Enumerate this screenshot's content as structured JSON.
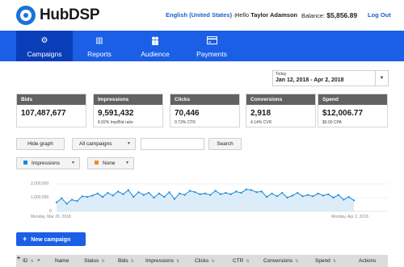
{
  "app": {
    "logo_text": "HubDSP"
  },
  "topbar": {
    "language": "English (United States)",
    "lang_caret": "◇",
    "hello_prefix": "Hello",
    "user_name": "Taylor Adamson",
    "balance_label": "Balance:",
    "balance_value": "$5,856.89",
    "logout": "Log Out"
  },
  "nav": {
    "items": [
      {
        "label": "Campaigns",
        "icon": "gears-icon",
        "glyph": "⚙"
      },
      {
        "label": "Reports",
        "icon": "bar-chart-icon",
        "glyph": "▥"
      },
      {
        "label": "Audience",
        "icon": "people-icon",
        "glyph": "👥"
      },
      {
        "label": "Payments",
        "icon": "card-icon",
        "glyph": "▭"
      }
    ],
    "active_index": 0
  },
  "datepicker": {
    "label": "Today",
    "range": "Jan 12, 2018 - Apr 2, 2018",
    "caret": "▼"
  },
  "cards": [
    {
      "title": "Bids",
      "value": "107,487,677",
      "sub": ""
    },
    {
      "title": "Impressions",
      "value": "9,591,432",
      "sub": "8.92% Imp/Bid ratio"
    },
    {
      "title": "Clicks",
      "value": "70,446",
      "sub": "0.73% CTR"
    },
    {
      "title": "Conversions",
      "value": "2,918",
      "sub": "4.14% CVR"
    },
    {
      "title": "Spend",
      "value": "$12,006.77",
      "sub": "$0.00 CPA"
    }
  ],
  "controls": {
    "hide_graph": "Hide graph",
    "campaign_filter": "All campaigns",
    "search_placeholder": "",
    "search_button": "Search",
    "metric1": "Impressions",
    "metric2": "None",
    "caret": "▼"
  },
  "colors": {
    "accent": "#1a5fe6",
    "series1": "#1e88d6",
    "series2": "#f08a24",
    "card_head": "#626262"
  },
  "chart_data": {
    "type": "area",
    "x_start_label": "Monday, Mar 26, 2018",
    "x_end_label": "Monday, Apr 2, 2018",
    "y_ticks": [
      "2,000,000",
      "1,000,000",
      "0"
    ],
    "ylim": [
      0,
      2000000
    ],
    "series": [
      {
        "name": "Impressions",
        "values": [
          650000,
          950000,
          550000,
          850000,
          750000,
          1100000,
          1050000,
          1150000,
          1300000,
          1050000,
          1350000,
          1150000,
          1450000,
          1250000,
          1550000,
          1050000,
          1400000,
          1200000,
          1350000,
          1000000,
          1300000,
          1050000,
          1400000,
          900000,
          1300000,
          1200000,
          1500000,
          1400000,
          1250000,
          1300000,
          1200000,
          1500000,
          1250000,
          1350000,
          1250000,
          1450000,
          1350000,
          1600000,
          1550000,
          1400000,
          1450000,
          1050000,
          1300000,
          1100000,
          1350000,
          1000000,
          1150000,
          1350000,
          1100000,
          1200000,
          1100000,
          1300000,
          1150000,
          1250000,
          1000000,
          1200000,
          850000,
          1050000,
          800000
        ]
      }
    ]
  },
  "new_campaign": {
    "plus": "+",
    "label": "New campaign"
  },
  "table": {
    "corner": "+",
    "columns": [
      "ID",
      "●",
      "Name",
      "Status",
      "Bids",
      "Impressions",
      "Clicks",
      "CTR",
      "Conversions",
      "Spend",
      "Actions"
    ],
    "sort_glyph": "⇅"
  }
}
